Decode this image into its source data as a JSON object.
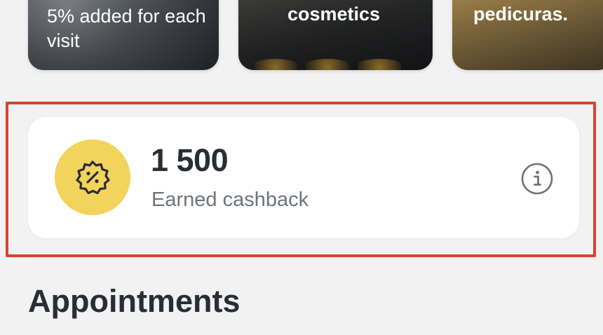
{
  "promos": [
    {
      "text": "5% added for each visit"
    },
    {
      "text": "cosmetics"
    },
    {
      "text": "pedicuras."
    }
  ],
  "cashback": {
    "amount": "1 500",
    "label": "Earned cashback",
    "badge_icon": "discount-badge-icon",
    "info_icon": "info-icon",
    "badge_color": "#f2d45c"
  },
  "highlight_color": "#d9442e",
  "appointments": {
    "title": "Appointments"
  }
}
